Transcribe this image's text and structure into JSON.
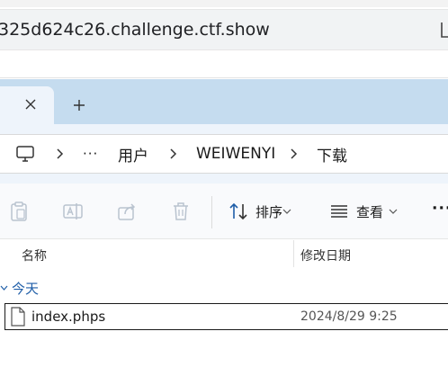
{
  "browser": {
    "address": "325d624c26.challenge.ctf.show"
  },
  "tabs": {
    "close_icon": "close-icon",
    "new_tab_icon": "plus-icon"
  },
  "breadcrumb": {
    "items": [
      "用户",
      "WEIWENYI",
      "下载"
    ],
    "overflow_label": "···"
  },
  "toolbar": {
    "sort_label": "排序",
    "view_label": "查看",
    "more_label": "···"
  },
  "list": {
    "columns": [
      "名称",
      "修改日期"
    ],
    "groups": [
      {
        "label": "今天",
        "files": [
          {
            "name": "index.phps",
            "modified": "2024/8/29 9:25"
          }
        ]
      }
    ]
  },
  "colors": {
    "tab_strip": "#c5dcef",
    "nav_background": "#eef4fb",
    "group_label": "#1f5ea8"
  }
}
